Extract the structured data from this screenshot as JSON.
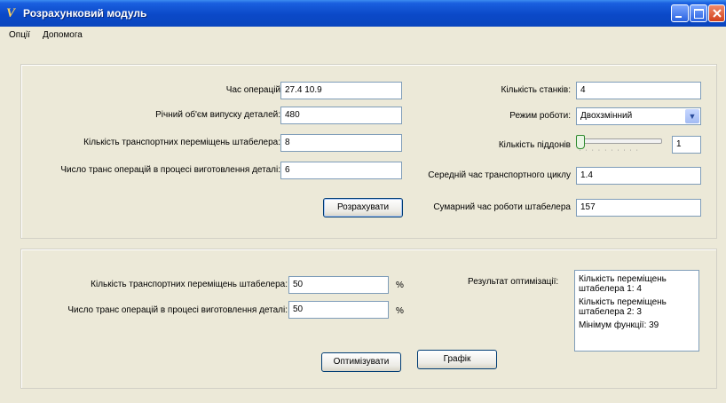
{
  "window": {
    "title": "Розрахунковий модуль"
  },
  "menu": {
    "items": [
      "Опції",
      "Допомога"
    ]
  },
  "top": {
    "op_time": {
      "label": "Час операцій",
      "value": "27.4 10.9"
    },
    "annual_volume": {
      "label": "Річний об'єм випуску деталей:",
      "value": "480"
    },
    "transport_moves": {
      "label": "Кількість транспортних переміщень штабелера:",
      "value": "8"
    },
    "trans_ops": {
      "label": "Число транс операцій в процесі виготовлення деталі:",
      "value": "6"
    },
    "calc_button": "Розрахувати",
    "machines": {
      "label": "Кількість станків:",
      "value": "4"
    },
    "mode": {
      "label": "Режим роботи:",
      "value": "Двохзмінний"
    },
    "pallets": {
      "label": "Кількість піддонів",
      "value": "1",
      "slider_level": 0
    },
    "avg_cycle": {
      "label": "Середній час транспортного циклу",
      "value": "1.4"
    },
    "total_time": {
      "label": "Сумарний час роботи штабелера",
      "value": "157"
    }
  },
  "bottom": {
    "transport_moves": {
      "label": "Кількість транспортних переміщень штабелера:",
      "value": "50",
      "unit": "%"
    },
    "trans_ops": {
      "label": "Число транс операцій в процесі виготовлення деталі:",
      "value": "50",
      "unit": "%"
    },
    "result_label": "Результат оптимізації:",
    "result_lines": [
      "Кількість переміщень штабелера 1: 4",
      "Кількість переміщень штабелера 2: 3",
      "Мінімум функції: 39"
    ],
    "optimize_button": "Оптимізувати",
    "graph_button": "Графік"
  }
}
